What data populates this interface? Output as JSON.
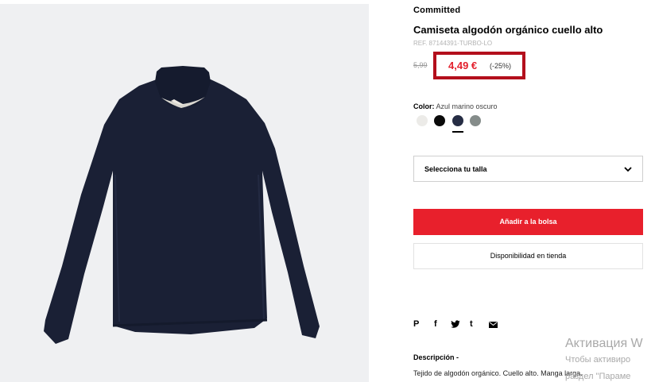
{
  "product": {
    "brand": "Committed",
    "title": "Camiseta algodón orgánico cuello alto",
    "ref": "REF. 87144391-TURBO-LO",
    "old_price": "5,99",
    "new_price": "4,49 €",
    "discount": "(-25%)"
  },
  "color": {
    "label": "Color:",
    "value": "Azul marino oscuro",
    "swatches": [
      "#ecebe8",
      "#0a0a0a",
      "#262d44",
      "#858c8a"
    ],
    "selected_index": 2
  },
  "size_select": {
    "label": "Selecciona tu talla"
  },
  "buttons": {
    "add_to_bag": "Añadir a la bolsa",
    "store_availability": "Disponibilidad en tienda"
  },
  "share": [
    "pinterest-icon",
    "facebook-icon",
    "twitter-icon",
    "tumblr-icon",
    "email-icon"
  ],
  "description": {
    "title": "Descripción -",
    "text": "Tejido de algodón orgánico. Cuello alto. Manga larga."
  },
  "watermark": {
    "line1": "Активация W",
    "line2": "Чтобы активиро",
    "line3": "раздел \"Параме"
  },
  "colors": {
    "accent": "#e8202c",
    "price": "#e31f2c",
    "highlight": "#b30f1c"
  }
}
